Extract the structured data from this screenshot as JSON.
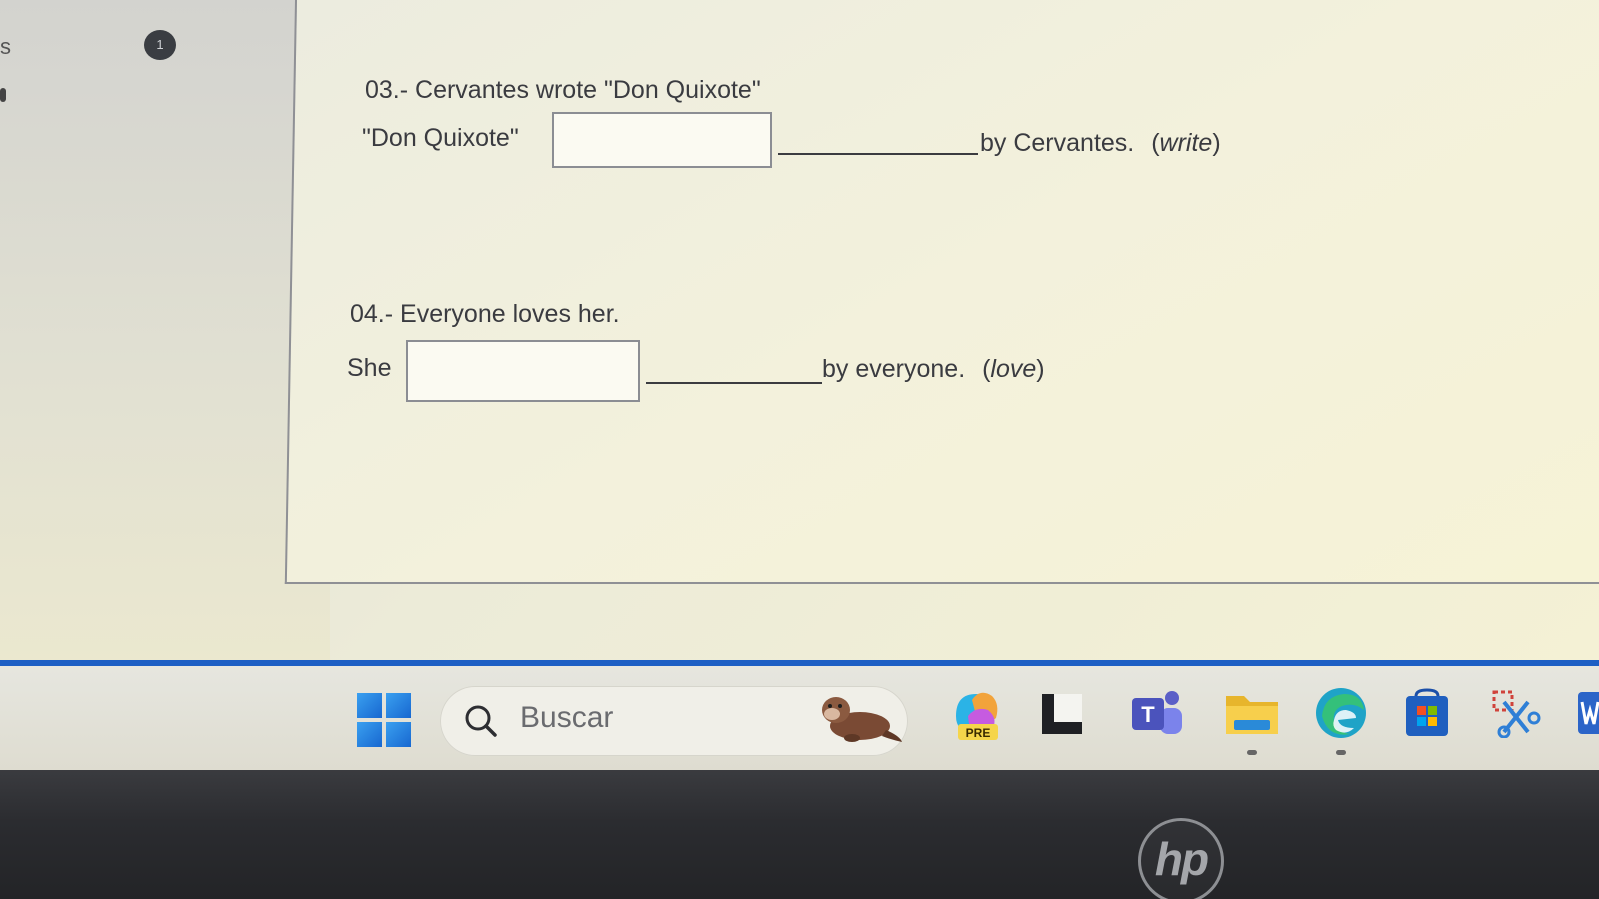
{
  "sidebar": {
    "left_letter": "s",
    "badge_count": "1"
  },
  "exercise": {
    "q3": {
      "title": "03.- Cervantes wrote \"Don Quixote\"",
      "subject": "\"Don Quixote\"",
      "answer_value": "",
      "rest": "by Cervantes.",
      "hint_open": "(",
      "hint_verb": "write",
      "hint_close": ")"
    },
    "q4": {
      "title": "04.- Everyone loves her.",
      "subject": "She",
      "answer_value": "",
      "rest": "by everyone.",
      "hint_open": "(",
      "hint_verb": "love",
      "hint_close": ")"
    }
  },
  "taskbar": {
    "search_placeholder": "Buscar",
    "copilot_badge": "PRE",
    "teams_letter": "T",
    "icons": [
      "windows-start-icon",
      "search-icon",
      "otter-widget-icon",
      "copilot-pre-icon",
      "task-view-icon",
      "teams-icon",
      "file-explorer-icon",
      "edge-icon",
      "microsoft-store-icon",
      "snipping-tool-icon",
      "word-icon"
    ]
  },
  "hardware": {
    "brand_logo": "hp"
  },
  "colors": {
    "taskbar_accent": "#1d5fc4",
    "panel_bg": "#f3f1dc",
    "text": "#3a3b40"
  }
}
